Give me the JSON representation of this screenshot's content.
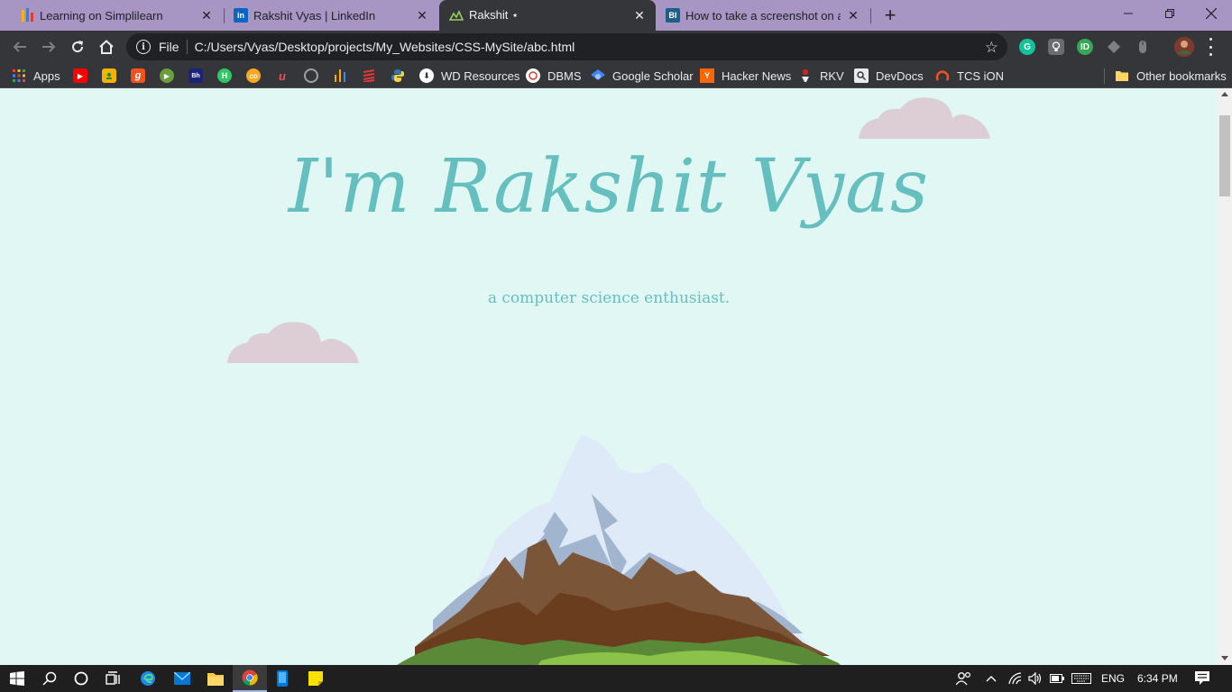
{
  "browser": {
    "tabs": [
      {
        "title": "Learning on Simplilearn",
        "favicon": "simplilearn-icon",
        "active": false
      },
      {
        "title": "Rakshit Vyas | LinkedIn",
        "favicon": "linkedin-icon",
        "active": false
      },
      {
        "title": "Rakshit ⋆",
        "favicon": "mountain-icon",
        "active": true
      },
      {
        "title": "How to take a screenshot on any",
        "favicon": "bi-icon",
        "active": false
      }
    ],
    "address": {
      "scheme": "File",
      "url": "C:/Users/Vyas/Desktop/projects/My_Websites/CSS-MySite/abc.html"
    },
    "bookmarks": [
      {
        "label": "Apps",
        "icon": "apps-grid-icon"
      },
      {
        "label": "",
        "icon": "youtube-icon"
      },
      {
        "label": "",
        "icon": "classroom-icon"
      },
      {
        "label": "",
        "icon": "g-icon"
      },
      {
        "label": "",
        "icon": "play-icon"
      },
      {
        "label": "",
        "icon": "bh-icon"
      },
      {
        "label": "",
        "icon": "hackerrank-icon"
      },
      {
        "label": "",
        "icon": "coursera-icon"
      },
      {
        "label": "",
        "icon": "udemy-icon"
      },
      {
        "label": "",
        "icon": "swirl-icon"
      },
      {
        "label": "",
        "icon": "chart-icon"
      },
      {
        "label": "",
        "icon": "stack-icon"
      },
      {
        "label": "",
        "icon": "python-icon"
      },
      {
        "label": "WD Resources",
        "icon": "wd-icon"
      },
      {
        "label": "DBMS",
        "icon": "dbms-icon"
      },
      {
        "label": "Google Scholar",
        "icon": "scholar-icon"
      },
      {
        "label": "Hacker News",
        "icon": "ycombinator-icon"
      },
      {
        "label": "RKV",
        "icon": "rkv-icon"
      },
      {
        "label": "DevDocs",
        "icon": "devdocs-icon"
      },
      {
        "label": "TCS iON",
        "icon": "tcs-icon"
      }
    ],
    "other_bookmarks": "Other bookmarks"
  },
  "page": {
    "heading": "I'm Rakshit Vyas",
    "tagline": "a computer science enthusiast."
  },
  "taskbar": {
    "language": "ENG",
    "time": "6:34 PM"
  },
  "colors": {
    "page_bg": "#e0f7f4",
    "accent": "#66bfbf",
    "cloud": "#dcced4",
    "tab_strip": "#a795c4"
  }
}
